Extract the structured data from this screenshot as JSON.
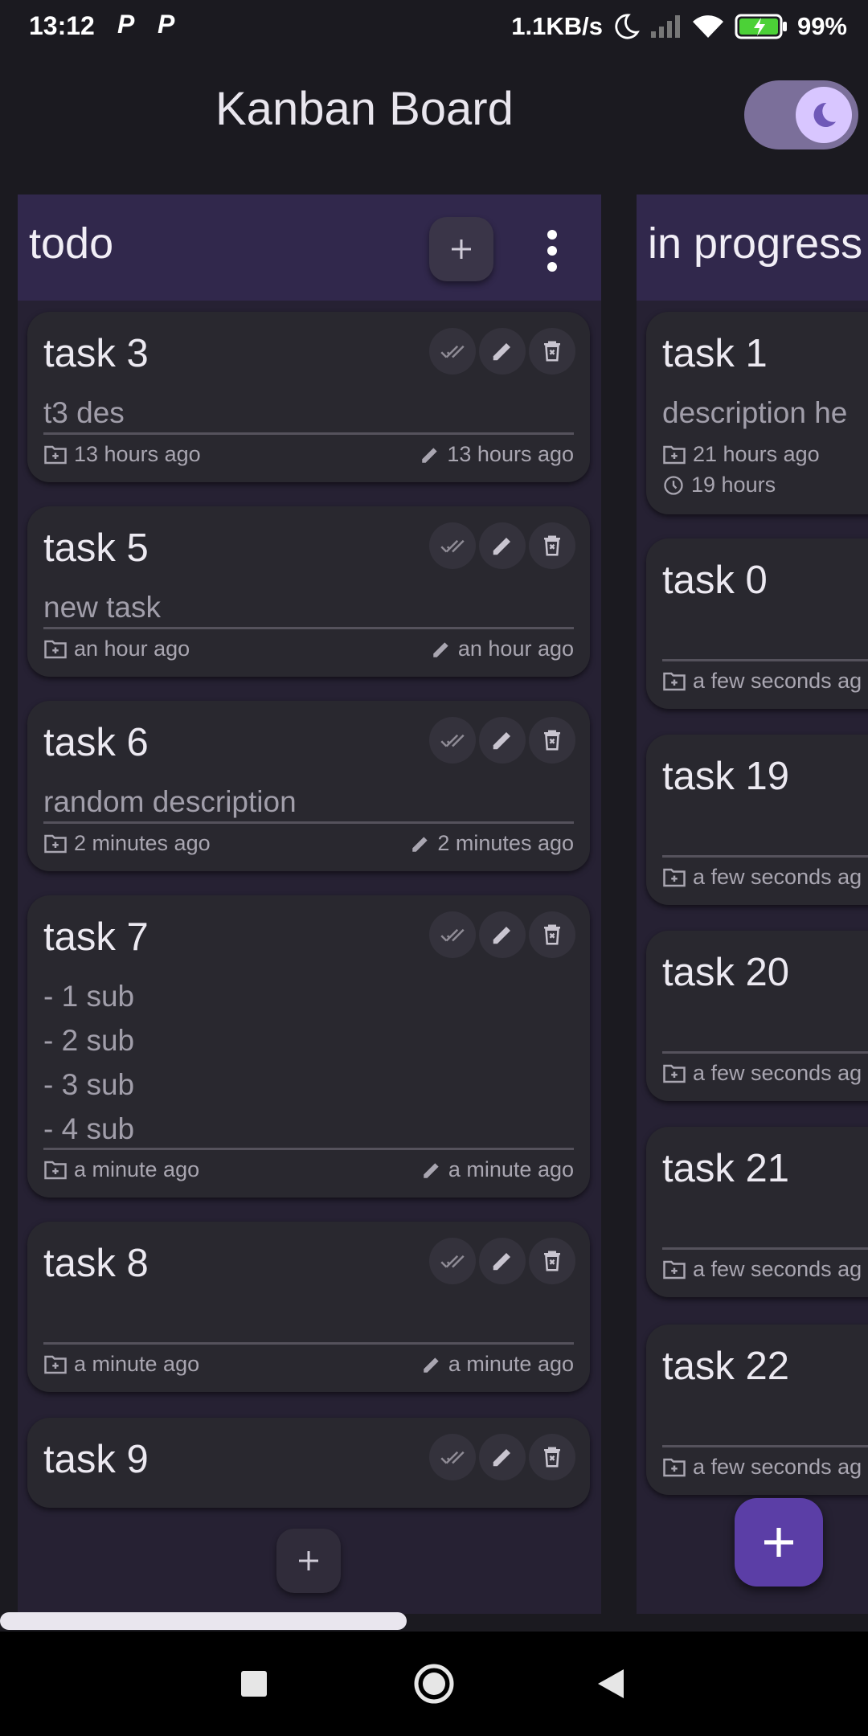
{
  "status_bar": {
    "time": "13:12",
    "app_icons": [
      "P",
      "P"
    ],
    "network_speed": "1.1KB/s",
    "battery_percent": "99%",
    "icons": [
      "moon-icon",
      "signal-icon",
      "wifi-icon",
      "battery-charging-icon"
    ]
  },
  "app_bar": {
    "title": "Kanban Board",
    "theme_toggle": {
      "state": "on",
      "icon": "moon-icon"
    }
  },
  "columns": [
    {
      "title": "todo",
      "cards": [
        {
          "title": "task 3",
          "description": "t3 des",
          "created": "13 hours ago",
          "edited": "13 hours ago"
        },
        {
          "title": "task 5",
          "description": "new task",
          "created": "an hour ago",
          "edited": "an hour ago"
        },
        {
          "title": "task 6",
          "description": "random description",
          "created": "2 minutes ago",
          "edited": "2 minutes ago"
        },
        {
          "title": "task 7",
          "description": "- 1 sub\n- 2 sub\n- 3 sub\n- 4 sub",
          "created": "a minute ago",
          "edited": "a minute ago"
        },
        {
          "title": "task 8",
          "description": "",
          "created": "a minute ago",
          "edited": "a minute ago"
        },
        {
          "title": "task 9",
          "description": ""
        }
      ]
    },
    {
      "title": "in progress",
      "cards": [
        {
          "title": "task 1",
          "description": "description he",
          "created": "21 hours ago",
          "time_spent": "19 hours"
        },
        {
          "title": "task 0",
          "created": "a few seconds ag"
        },
        {
          "title": "task 19",
          "created": "a few seconds ag"
        },
        {
          "title": "task 20",
          "created": "a few seconds ag"
        },
        {
          "title": "task 21",
          "created": "a few seconds ag"
        },
        {
          "title": "task 22",
          "created": "a few seconds ag"
        }
      ]
    }
  ],
  "card_action_icons": [
    "done-all-icon",
    "edit-icon",
    "delete-icon"
  ],
  "colors": {
    "background": "#1b1a20",
    "column": "#262133",
    "column_header": "#31284c",
    "card": "#29282f",
    "fab": "#5b3ea6",
    "toggle_track": "#7b6f9a",
    "toggle_thumb": "#d8c6ff"
  },
  "nav_bar": {
    "icons": [
      "recents-square-icon",
      "home-circle-icon",
      "back-triangle-icon"
    ]
  }
}
